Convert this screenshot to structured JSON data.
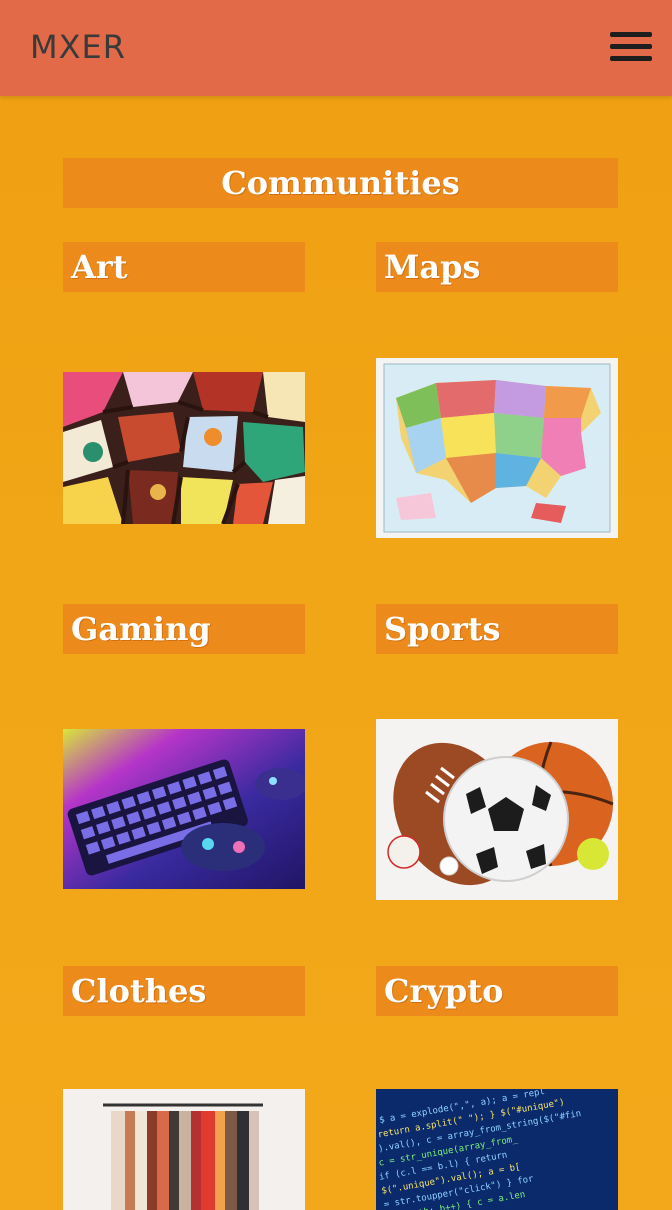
{
  "header": {
    "brand": "MXER",
    "menu_icon": "hamburger-menu-icon",
    "colors": {
      "bar": "#e36a48",
      "brand_text": "#3a3a3a"
    }
  },
  "page": {
    "title": "Communities",
    "background": "#f0a414",
    "label_background": "#ec8a1c"
  },
  "communities": [
    {
      "label": "Art",
      "image": "stained-glass-art-image"
    },
    {
      "label": "Maps",
      "image": "usa-map-image"
    },
    {
      "label": "Gaming",
      "image": "keyboard-controller-image"
    },
    {
      "label": "Sports",
      "image": "sports-balls-image"
    },
    {
      "label": "Clothes",
      "image": "clothing-rack-image"
    },
    {
      "label": "Crypto",
      "image": "code-screen-image"
    }
  ]
}
